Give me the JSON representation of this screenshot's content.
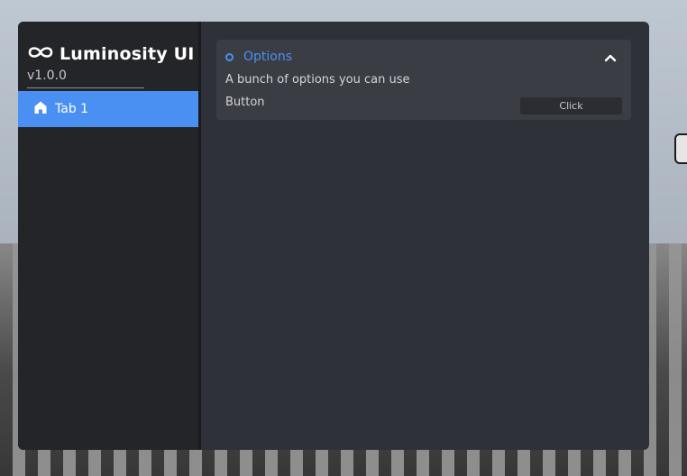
{
  "app": {
    "title": "Luminosity UI",
    "version": "v1.0.0",
    "logo_icon": "infinity-icon",
    "accent_color": "#4a8ff2"
  },
  "sidebar": {
    "tabs": [
      {
        "label": "Tab 1",
        "icon": "home-icon",
        "active": true
      }
    ]
  },
  "section": {
    "title": "Options",
    "description": "A bunch of options you can use",
    "collapse_icon": "chevron-up-icon",
    "rows": [
      {
        "label": "Button",
        "button_text": "Click"
      }
    ]
  }
}
